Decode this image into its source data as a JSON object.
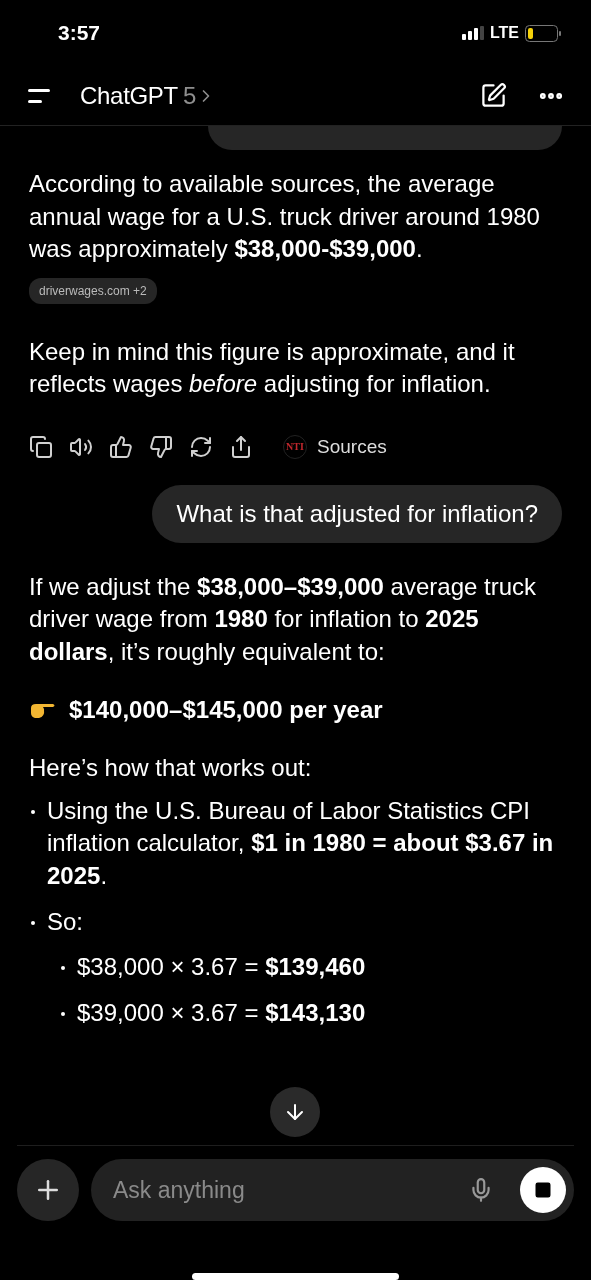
{
  "status_bar": {
    "time": "3:57",
    "network": "LTE"
  },
  "header": {
    "title": "ChatGPT",
    "model": "5"
  },
  "messages": [
    {
      "kind": "user"
    },
    {
      "kind": "assistant",
      "blocks": [
        {
          "kind": "paragraph",
          "text": "According to available sources, the average annual wage for a U.S. truck driver around 1980 was approximately **$38,000-$39,000**."
        },
        {
          "kind": "chip",
          "text": "driverwages.com +2"
        },
        {
          "kind": "paragraph",
          "text": "Keep in mind this figure is approximate, and it reflects wages *before* adjusting for inflation."
        },
        {
          "kind": "actions",
          "logo": "NTI",
          "sources": "Sources"
        }
      ]
    },
    {
      "kind": "user",
      "text": "What is that adjusted for inflation?"
    },
    {
      "kind": "assistant",
      "blocks": [
        {
          "kind": "paragraph",
          "text": "If we adjust the **$38,000–$39,000** average truck driver wage from **1980** for inflation to **2025 dollars**, it’s roughly equivalent to:"
        },
        {
          "kind": "callout",
          "text": "$140,000–$145,000 per year"
        },
        {
          "kind": "paragraph",
          "text": "Here’s how that works out:"
        },
        {
          "kind": "list",
          "items": [
            {
              "text": "Using the U.S. Bureau of Labor Statistics CPI inflation calculator, **$1 in 1980 = about $3.67 in 2025**."
            },
            {
              "text": "So:",
              "children": [
                {
                  "text": "$38,000 × 3.67 = **$139,460**"
                },
                {
                  "text": "$39,000 × 3.67 = **$143,130**"
                }
              ]
            }
          ]
        }
      ]
    }
  ],
  "composer": {
    "placeholder": "Ask anything"
  }
}
